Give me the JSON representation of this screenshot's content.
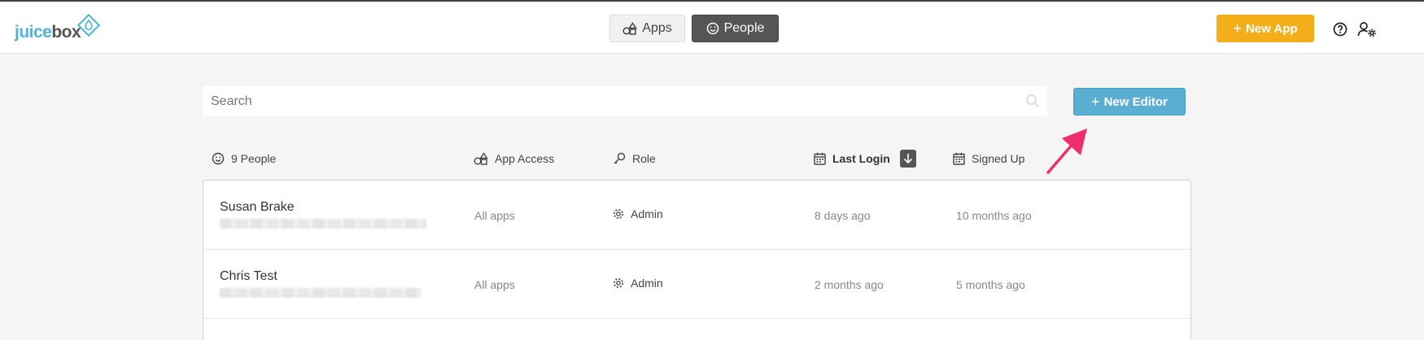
{
  "brand": {
    "part1": "juice",
    "part2": "box",
    "accent": "#4bb3d6"
  },
  "nav": {
    "tabs": [
      {
        "label": "Apps",
        "icon": "shapes-icon",
        "active": false
      },
      {
        "label": "People",
        "icon": "smiley-icon",
        "active": true
      }
    ]
  },
  "header": {
    "new_app_label": "New App",
    "new_app_color": "#f4ae1a",
    "help_icon": "help-icon",
    "user_settings_icon": "user-settings-icon"
  },
  "search": {
    "placeholder": "Search",
    "value": ""
  },
  "new_editor": {
    "label": "New Editor",
    "color": "#5aaed1"
  },
  "columns": {
    "people": "9 People",
    "app_access": "App Access",
    "role": "Role",
    "last_login": "Last Login",
    "signed_up": "Signed Up"
  },
  "rows": [
    {
      "name": "Susan Brake",
      "app_access": "All apps",
      "role": "Admin",
      "last_login": "8 days ago",
      "signed_up": "10 months ago"
    },
    {
      "name": "Chris Test",
      "app_access": "All apps",
      "role": "Admin",
      "last_login": "2 months ago",
      "signed_up": "5 months ago"
    }
  ]
}
